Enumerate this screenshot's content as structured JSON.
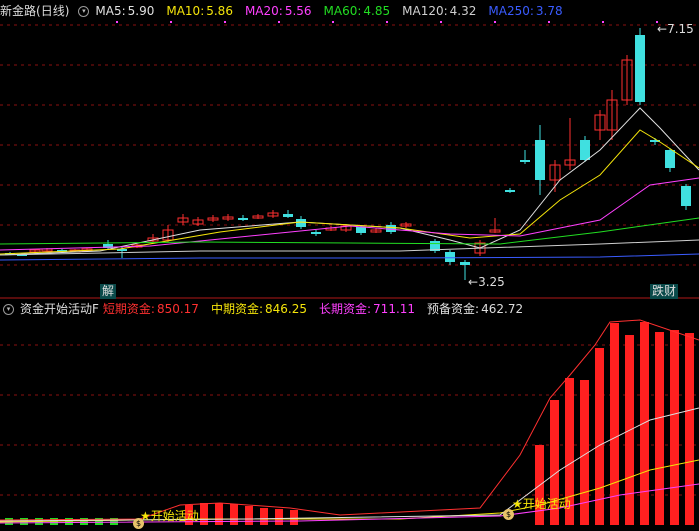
{
  "main_panel": {
    "stock_name": "新金路",
    "period": "(日线)",
    "ma_items": [
      {
        "label": "MA5:",
        "value": "5.90",
        "color": "#e0e0e0"
      },
      {
        "label": "MA10:",
        "value": "5.86",
        "color": "#f5e50a"
      },
      {
        "label": "MA20:",
        "value": "5.56",
        "color": "#ff40ff"
      },
      {
        "label": "MA60:",
        "value": "4.85",
        "color": "#22dd22"
      },
      {
        "label": "MA120:",
        "value": "4.32",
        "color": "#cfcfcf"
      },
      {
        "label": "MA250:",
        "value": "3.78",
        "color": "#3a5cff"
      }
    ],
    "high_label": "7.15",
    "low_label": "3.25",
    "tag_left": "解",
    "tag_right": "跌财"
  },
  "indicator_panel": {
    "name": "资金开始活动F",
    "items": [
      {
        "label": "短期资金:",
        "value": "850.17",
        "color": "#ff3030"
      },
      {
        "label": "中期资金:",
        "value": "846.25",
        "color": "#f5e50a"
      },
      {
        "label": "长期资金:",
        "value": "711.11",
        "color": "#ff40ff"
      },
      {
        "label": "预备资金:",
        "value": "462.72",
        "color": "#e0e0e0"
      }
    ],
    "signal_label": "开始活动",
    "signal_icon": "money-bag-icon"
  },
  "colors": {
    "up": "#ff3030",
    "down": "#40e0e0",
    "grid": "#8a1010",
    "bg": "#000000"
  }
}
